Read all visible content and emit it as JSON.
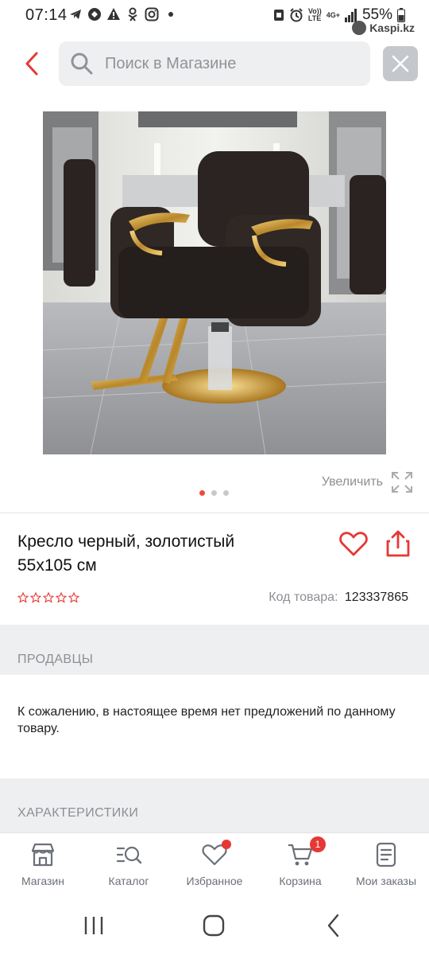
{
  "status_bar": {
    "time": "07:14",
    "battery": "55%",
    "network": "4G+",
    "volte": "Vo))\nLTE",
    "brand": "Kaspi.kz"
  },
  "header": {
    "search_placeholder": "Поиск в Магазине"
  },
  "gallery": {
    "zoom_label": "Увеличить",
    "image_alt": "barber-chair-photo",
    "pages_total": 3,
    "page_active": 1
  },
  "product": {
    "title_line1": "Кресло черный, золотистый",
    "title_line2": "55x105 см",
    "rating_stars": 0,
    "rating_max": 5,
    "code_label": "Код товара:",
    "code_value": "123337865"
  },
  "sections": {
    "sellers_title": "ПРОДАВЦЫ",
    "no_offers_text": "К сожалению, в настоящее время нет предложений по данному товару.",
    "specs_title": "ХАРАКТЕРИСТИКИ"
  },
  "bottom_nav": {
    "items": [
      {
        "label": "Магазин",
        "icon": "store-icon"
      },
      {
        "label": "Каталог",
        "icon": "catalog-search-icon"
      },
      {
        "label": "Избранное",
        "icon": "heart-icon"
      },
      {
        "label": "Корзина",
        "icon": "cart-icon",
        "badge": "1"
      },
      {
        "label": "Мои заказы",
        "icon": "orders-icon"
      }
    ]
  },
  "colors": {
    "accent": "#e53935",
    "muted_text": "#8c8f94",
    "band_bg": "#eeeff1"
  }
}
